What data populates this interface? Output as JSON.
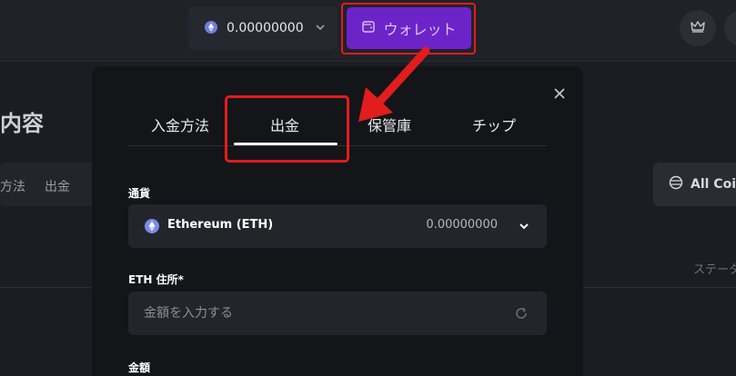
{
  "header": {
    "balance_amount": "0.00000000",
    "wallet_label": "ウォレット"
  },
  "background": {
    "title_fragment": "内容",
    "tab_fragment_1": "方法",
    "tab_fragment_2": "出金",
    "coins_filter_label": "All Coin",
    "status_header_fragment": "ステータ"
  },
  "modal": {
    "tabs": [
      {
        "label": "入金方法",
        "active": false
      },
      {
        "label": "出金",
        "active": true
      },
      {
        "label": "保管庫",
        "active": false
      },
      {
        "label": "チップ",
        "active": false
      }
    ],
    "currency_label": "通貨",
    "currency": {
      "name": "Ethereum (ETH)",
      "balance": "0.00000000"
    },
    "address_label": "ETH 住所*",
    "address_placeholder": "金額を入力する",
    "amount_label": "金額"
  },
  "colors": {
    "accent": "#6c24c9",
    "highlight": "#e11d1d",
    "eth": "#7b8be8"
  },
  "icons": [
    "eth-icon",
    "chevron-down-icon",
    "wallet-icon",
    "crown-icon",
    "close-icon",
    "coins-icon",
    "refresh-icon",
    "arrow-annotation"
  ]
}
